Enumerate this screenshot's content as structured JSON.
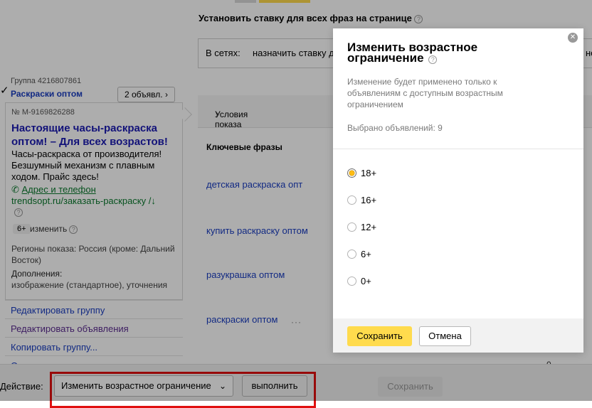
{
  "page": {
    "bulk_bid_title": "Установить ставку для всех фраз на странице",
    "networks_label": "В сетях:",
    "networks_value": "назначить ставку для",
    "networks_trailing": "не"
  },
  "group": {
    "id_label": "Группа 4216807861",
    "name": "Раскраски оптом",
    "ads_count_button": "2 объявл.",
    "ad": {
      "number": "№ М-9169826288",
      "title": "Настоящие часы-раскраска оптом! – Для всех возрастов!",
      "body": "Часы-раскраска от производителя! Безшумный механизм с плавным ходом. Прайс здесь!",
      "address_link": "Адрес и телефон",
      "url": "trendsopt.ru/заказать-раскраску /",
      "age_badge": "6+",
      "age_change_link": "изменить",
      "regions": "Регионы показа: Россия (кроме: Дальний Восток)",
      "addons_label": "Дополнения:",
      "addons_value": "изображение (стандартное), уточнения"
    },
    "links": [
      "Редактировать группу",
      "Редактировать объявления",
      "Копировать группу...",
      "Остановить"
    ]
  },
  "table": {
    "conditions_header": "Условия показа",
    "keywords_subheader": "Ключевые фразы",
    "keywords": [
      "детская раскраска опт",
      "купить раскраску оптом",
      "разукрашка оптом",
      "раскраски оптом"
    ],
    "more_dots": "···",
    "zero": "0"
  },
  "bottom_bar": {
    "action_label": "Действие:",
    "action_select_value": "Изменить возрастное ограничение",
    "execute_button": "выполнить",
    "save_button": "Сохранить"
  },
  "modal": {
    "title": "Изменить возрастное ограничение",
    "description": "Изменение будет применено только к объявлениям с доступным возрастным ограничением",
    "selected_count": "Выбрано объявлений: 9",
    "options": [
      "18+",
      "16+",
      "12+",
      "6+",
      "0+"
    ],
    "selected_option": "18+",
    "save_button": "Сохранить",
    "cancel_button": "Отмена"
  },
  "colors": {
    "accent_yellow": "#ffdb4d",
    "link_blue": "#1a3dc1",
    "ad_title_blue": "#1b1bb3",
    "url_green": "#0b7a2e",
    "highlight_red": "#e01010"
  },
  "icons": {
    "help": "help-circle-icon",
    "close": "close-circle-icon",
    "checkbox": "check-icon",
    "phone": "phone-icon",
    "dropdown": "chevron-down-icon"
  }
}
